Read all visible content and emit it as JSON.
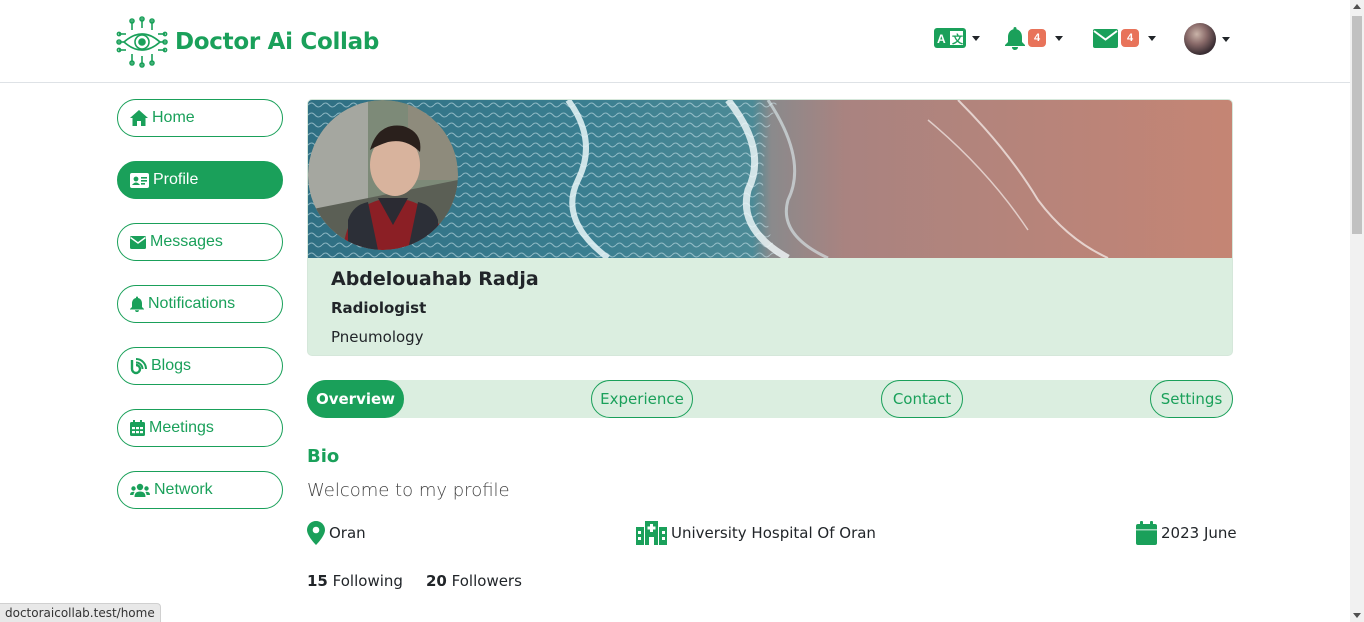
{
  "app": {
    "brand_name": "Doctor Ai Collab",
    "accent_color": "#1aa05a",
    "badge_color": "#e8735a"
  },
  "header": {
    "language_icon": "translate-icon",
    "notifications_count": "4",
    "messages_count": "4"
  },
  "sidebar": {
    "items": [
      {
        "label": "Home",
        "icon": "home-icon"
      },
      {
        "label": "Profile",
        "icon": "id-card-icon"
      },
      {
        "label": "Messages",
        "icon": "envelope-icon"
      },
      {
        "label": "Notifications",
        "icon": "bell-icon"
      },
      {
        "label": "Blogs",
        "icon": "blog-icon"
      },
      {
        "label": "Meetings",
        "icon": "calendar-icon"
      },
      {
        "label": "Network",
        "icon": "users-icon"
      }
    ],
    "active": "Profile"
  },
  "profile": {
    "name": "Abdelouahab Radja",
    "title": "Radiologist",
    "specialty": "Pneumology"
  },
  "tabs": [
    {
      "label": "Overview",
      "active": true
    },
    {
      "label": "Experience"
    },
    {
      "label": "Contact"
    },
    {
      "label": "Settings"
    }
  ],
  "bio": {
    "heading": "Bio",
    "text": "Welcome to my profile"
  },
  "info": {
    "location": "Oran",
    "workplace": "University Hospital Of Oran",
    "joined": "2023 June"
  },
  "stats": {
    "following_count": "15",
    "following_label": "Following",
    "followers_count": "20",
    "followers_label": "Followers"
  },
  "statusbar": {
    "url": "doctoraicollab.test/home"
  }
}
